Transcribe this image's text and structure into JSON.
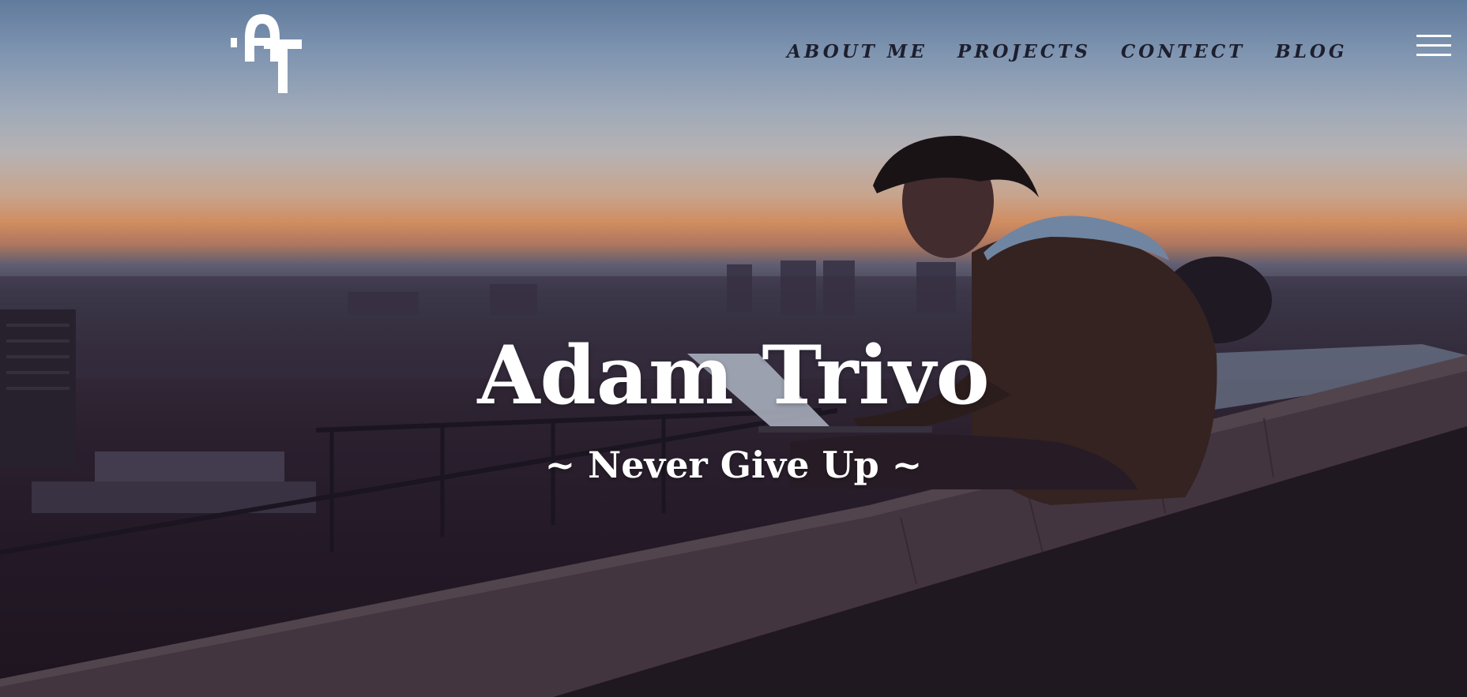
{
  "header": {
    "logo_icon": "at-monogram-logo",
    "nav": [
      {
        "label": "ABOUT ME"
      },
      {
        "label": "PROJECTS"
      },
      {
        "label": "CONTECT"
      },
      {
        "label": "BLOG"
      }
    ],
    "menu_icon": "hamburger-menu-icon"
  },
  "hero": {
    "title": "Adam Trivo",
    "tagline": "~ Never Give Up ~",
    "background_image": "man-with-laptop-on-wall-at-dusk-over-city"
  },
  "colors": {
    "nav_text": "#1d1f2e",
    "hero_text": "#ffffff",
    "sky_top": "#6d8fb3",
    "sunset_band": "#f0a36b"
  }
}
